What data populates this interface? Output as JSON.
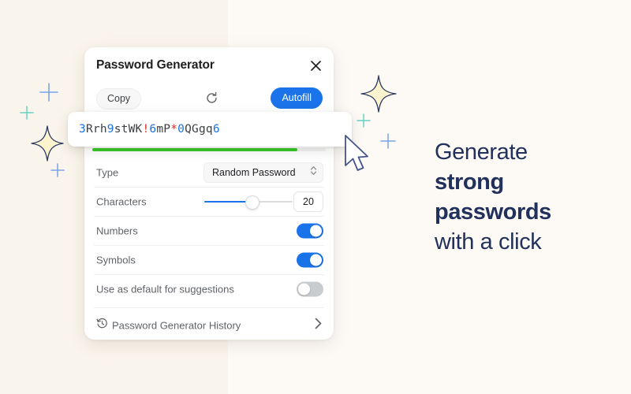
{
  "popup": {
    "title": "Password Generator",
    "close_icon": "close-icon",
    "actions": {
      "copy_label": "Copy",
      "refresh_icon": "refresh-icon",
      "autofill_label": "Autofill"
    },
    "password": {
      "value": "3Rrh9stWK!6mP*0QGgq6",
      "digit_color": "#1a73e8",
      "symbol_color": "#d93025",
      "letter_color": "#3c4043"
    },
    "strength": {
      "percent": 88,
      "color": "#34c724"
    },
    "rows": [
      {
        "name": "type",
        "label": "Type",
        "control": "select",
        "value": "Random Password"
      },
      {
        "name": "characters",
        "label": "Characters",
        "control": "slider",
        "value": "20",
        "slider_percent": 54
      },
      {
        "name": "numbers",
        "label": "Numbers",
        "control": "toggle",
        "value": "on"
      },
      {
        "name": "symbols",
        "label": "Symbols",
        "control": "toggle",
        "value": "on"
      },
      {
        "name": "use-as-default",
        "label": "Use as default for suggestions",
        "control": "toggle",
        "value": "off"
      }
    ],
    "history": {
      "icon": "history-clock-icon",
      "label": "Password Generator History",
      "chevron": "chevron-right-icon"
    }
  },
  "marketing": {
    "line1": "Generate",
    "line2": "strong",
    "line3": "passwords",
    "line4": "with a click",
    "text_color": "#22315c"
  },
  "decor": {
    "cursor_icon": "mouse-pointer-icon",
    "star_color": "#fdf3cf",
    "plus_blue": "#7aa3e8",
    "plus_teal": "#67d3c4"
  }
}
